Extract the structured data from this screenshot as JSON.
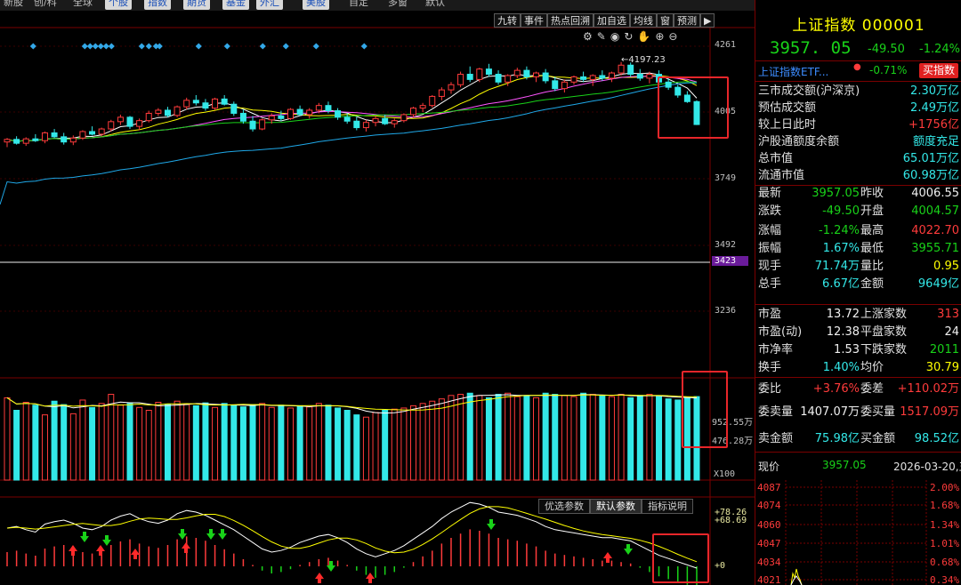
{
  "top_tabs": [
    {
      "label": "新股",
      "btn": false
    },
    {
      "label": "创/科",
      "btn": false
    },
    {
      "label": "全球",
      "btn": false
    },
    {
      "label": "个股",
      "btn": true
    },
    {
      "label": "指数",
      "btn": true
    },
    {
      "label": "期货",
      "btn": true
    },
    {
      "label": "基金",
      "btn": true
    },
    {
      "label": "外汇",
      "btn": true
    },
    {
      "label": "美股",
      "btn": true
    },
    {
      "label": "自定",
      "btn": false
    },
    {
      "label": "多窗",
      "btn": false
    },
    {
      "label": "默认",
      "btn": false
    }
  ],
  "chart_toolbar": [
    "九转",
    "事件",
    "热点回溯",
    "加自选",
    "均线",
    "窗",
    "预测",
    "▶"
  ],
  "price_axis": {
    "p4261": "4261",
    "p4005": "4005",
    "p3749": "3749",
    "p3492": "3492",
    "p3423": "3423",
    "p3236": "3236"
  },
  "peak_label": "4197.23",
  "volume_axis": {
    "v1": "952.55万",
    "v2": "476.28万",
    "unit": "X100"
  },
  "macd_axis": {
    "a": "78.26",
    "b": "68.69",
    "zero": "0"
  },
  "param_tabs": [
    "优选参数",
    "默认参数",
    "指标说明"
  ],
  "colors": {
    "up": "#ff3b3b",
    "down": "#33e8e8",
    "ma5": "#ffffff",
    "ma10": "#ffff00",
    "ma20": "#ff55ff",
    "ma30": "#19d219",
    "ma60": "#1fa8e8"
  },
  "candles": [
    [
      3890,
      3905,
      3870,
      3900
    ],
    [
      3900,
      3912,
      3880,
      3885
    ],
    [
      3885,
      3908,
      3875,
      3902
    ],
    [
      3902,
      3920,
      3890,
      3895
    ],
    [
      3895,
      3930,
      3885,
      3925
    ],
    [
      3925,
      3940,
      3905,
      3910
    ],
    [
      3910,
      3925,
      3880,
      3890
    ],
    [
      3890,
      3915,
      3878,
      3905
    ],
    [
      3905,
      3935,
      3898,
      3930
    ],
    [
      3930,
      3950,
      3915,
      3920
    ],
    [
      3920,
      3945,
      3912,
      3940
    ],
    [
      3940,
      3975,
      3930,
      3968
    ],
    [
      3968,
      3995,
      3955,
      3985
    ],
    [
      3985,
      3990,
      3940,
      3950
    ],
    [
      3950,
      3980,
      3935,
      3972
    ],
    [
      3972,
      4010,
      3965,
      4000
    ],
    [
      4000,
      4020,
      3990,
      4012
    ],
    [
      4012,
      4025,
      3985,
      3992
    ],
    [
      3992,
      4030,
      3985,
      4025
    ],
    [
      4025,
      4060,
      4015,
      4050
    ],
    [
      4050,
      4070,
      4030,
      4040
    ],
    [
      4040,
      4055,
      4010,
      4020
    ],
    [
      4020,
      4060,
      4012,
      4055
    ],
    [
      4055,
      4070,
      4030,
      4035
    ],
    [
      4035,
      4045,
      3990,
      4000
    ],
    [
      4000,
      4015,
      3960,
      3970
    ],
    [
      3970,
      3990,
      3930,
      3940
    ],
    [
      3940,
      3980,
      3935,
      3975
    ],
    [
      3975,
      4000,
      3960,
      3990
    ],
    [
      3990,
      4010,
      3970,
      3980
    ],
    [
      3980,
      4020,
      3975,
      4015
    ],
    [
      4015,
      4030,
      3990,
      3995
    ],
    [
      3995,
      4020,
      3980,
      4012
    ],
    [
      4012,
      4040,
      4000,
      4030
    ],
    [
      4030,
      4045,
      4000,
      4010
    ],
    [
      4010,
      4020,
      3975,
      3985
    ],
    [
      3985,
      4000,
      3960,
      3970
    ],
    [
      3970,
      3985,
      3935,
      3945
    ],
    [
      3945,
      3975,
      3930,
      3965
    ],
    [
      3965,
      3990,
      3950,
      3980
    ],
    [
      3980,
      3995,
      3955,
      3960
    ],
    [
      3960,
      3980,
      3945,
      3972
    ],
    [
      3972,
      4000,
      3965,
      3995
    ],
    [
      3995,
      4025,
      3985,
      4020
    ],
    [
      4020,
      4040,
      4005,
      4030
    ],
    [
      4030,
      4070,
      4022,
      4065
    ],
    [
      4065,
      4100,
      4050,
      4090
    ],
    [
      4090,
      4120,
      4075,
      4110
    ],
    [
      4110,
      4160,
      4100,
      4150
    ],
    [
      4150,
      4180,
      4120,
      4130
    ],
    [
      4130,
      4175,
      4120,
      4170
    ],
    [
      4170,
      4190,
      4140,
      4150
    ],
    [
      4150,
      4165,
      4110,
      4120
    ],
    [
      4120,
      4150,
      4105,
      4145
    ],
    [
      4145,
      4175,
      4135,
      4165
    ],
    [
      4165,
      4180,
      4130,
      4140
    ],
    [
      4140,
      4160,
      4120,
      4155
    ],
    [
      4155,
      4170,
      4115,
      4125
    ],
    [
      4125,
      4140,
      4085,
      4095
    ],
    [
      4095,
      4130,
      4080,
      4120
    ],
    [
      4120,
      4145,
      4110,
      4140
    ],
    [
      4140,
      4160,
      4120,
      4130
    ],
    [
      4130,
      4150,
      4105,
      4145
    ],
    [
      4145,
      4165,
      4125,
      4135
    ],
    [
      4135,
      4160,
      4120,
      4155
    ],
    [
      4155,
      4197,
      4145,
      4185
    ],
    [
      4185,
      4195,
      4140,
      4150
    ],
    [
      4150,
      4170,
      4125,
      4135
    ],
    [
      4135,
      4160,
      4115,
      4150
    ],
    [
      4150,
      4165,
      4110,
      4120
    ],
    [
      4120,
      4140,
      4090,
      4100
    ],
    [
      4100,
      4110,
      4060,
      4070
    ],
    [
      4070,
      4085,
      4040,
      4045
    ],
    [
      4045,
      4050,
      3955,
      3957
    ]
  ],
  "volumes": [
    820,
    600,
    740,
    690,
    520,
    760,
    700,
    540,
    780,
    650,
    720,
    880,
    690,
    720,
    650,
    600,
    740,
    710,
    760,
    700,
    680,
    730,
    650,
    720,
    690,
    660,
    700,
    720,
    650,
    690,
    640,
    680,
    660,
    720,
    690,
    640,
    600,
    520,
    480,
    560,
    600,
    620,
    640,
    680,
    720,
    760,
    800,
    860,
    880,
    900,
    860,
    820,
    880,
    900,
    840,
    860,
    820,
    900,
    880,
    860,
    840,
    900,
    880,
    860,
    840,
    880,
    820,
    860,
    880,
    840,
    800,
    780,
    820,
    840
  ],
  "macd_bars": [
    20,
    22,
    18,
    15,
    25,
    28,
    30,
    26,
    20,
    18,
    22,
    30,
    35,
    38,
    32,
    28,
    26,
    30,
    38,
    42,
    40,
    36,
    30,
    24,
    18,
    10,
    2,
    -6,
    -10,
    -8,
    -4,
    2,
    6,
    10,
    12,
    8,
    2,
    -6,
    -12,
    -16,
    -12,
    -8,
    -2,
    6,
    14,
    22,
    32,
    40,
    46,
    52,
    50,
    46,
    40,
    38,
    36,
    32,
    28,
    22,
    18,
    16,
    14,
    12,
    10,
    8,
    8,
    6,
    4,
    -2,
    -8,
    -14,
    -18,
    -22,
    -26,
    -30
  ]
}
